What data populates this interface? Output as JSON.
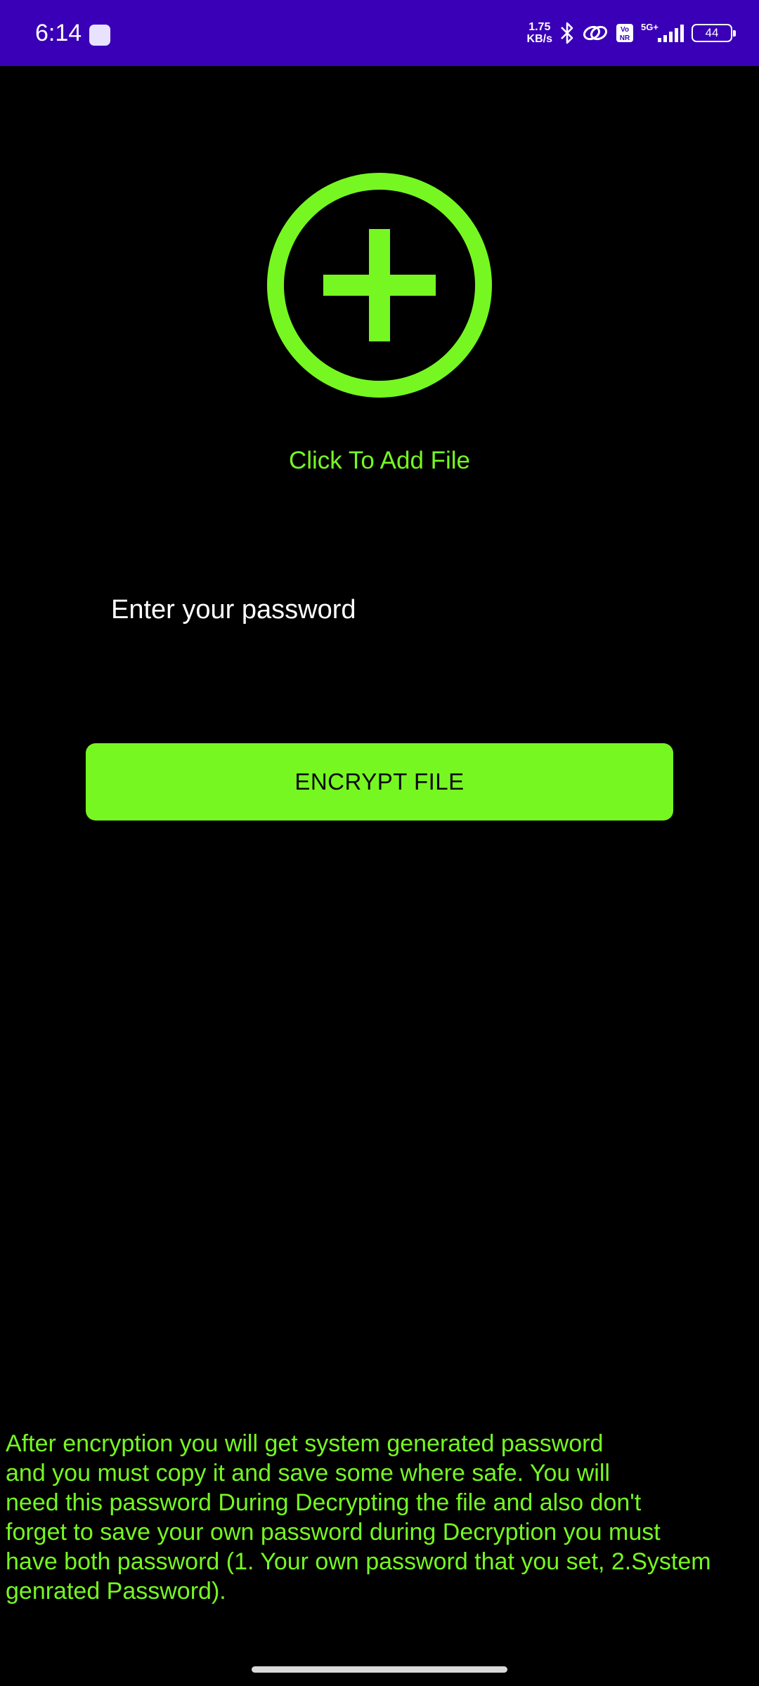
{
  "status_bar": {
    "time": "6:14",
    "net_speed_value": "1.75",
    "net_speed_unit": "KB/s",
    "volte_label": "Vo NR",
    "network_label": "5G+",
    "battery_level": "44",
    "background_color": "#3a00b7"
  },
  "main": {
    "add_file_icon": "add-circle-icon",
    "add_file_label": "Click To Add File",
    "password_placeholder": "Enter your password",
    "encrypt_button_label": "ENCRYPT FILE",
    "accent_color": "#76f722",
    "background_color": "#000000"
  },
  "info": {
    "lines": [
      "After encryption you will get system generated password",
      "and you must copy it and save some where safe. You will",
      "need this password During Decrypting the file and also don't",
      "forget to save your own password during Decryption you must",
      "have both password (1. Your own password that you set, 2.System",
      "genrated Password)."
    ]
  }
}
